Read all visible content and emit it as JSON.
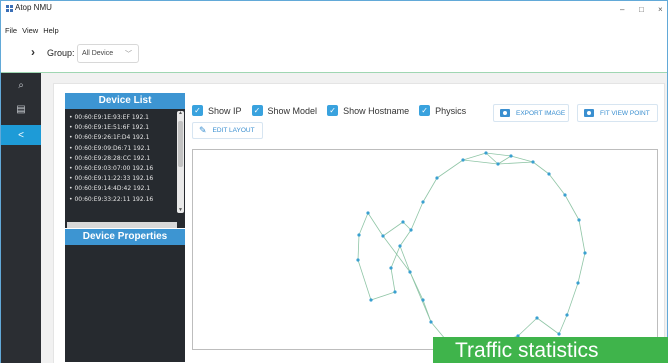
{
  "app": {
    "title": "Atop NMU",
    "window_controls": [
      "–",
      "□",
      "×"
    ]
  },
  "menu": [
    "File",
    "View",
    "Help"
  ],
  "group_bar": {
    "chevron_icon": "chevron-right-icon",
    "label": "Group:",
    "selected": "All Device",
    "dropdown_icon": "chevron-down-icon"
  },
  "sidebar": {
    "items": [
      {
        "icon": "search-icon",
        "glyph": "⌕"
      },
      {
        "icon": "list-icon",
        "glyph": "▤"
      },
      {
        "icon": "share-icon",
        "glyph": "<",
        "active": true
      }
    ]
  },
  "device_list": {
    "title": "Device List",
    "items": [
      "• 00:60:E9:1E:93:EF   192.1",
      "• 00:60:E9:1E:51:6F   192.1",
      "• 00:60:E9:26:1F:D4   192.1",
      "• 00:60:E9:09:D6:71   192.1",
      "• 00:60:E9:28:28:CC   192.1",
      "• 00:60:E9:03:07:00   192.16",
      "• 00:60:E9:11:22:33   192.16",
      "• 00:60:E9:14:4D:42   192.1",
      "• 00:60:E9:33:22:11   192.16"
    ]
  },
  "device_properties": {
    "title": "Device Properties"
  },
  "toolbar": {
    "show_ip": "Show IP",
    "show_model": "Show Model",
    "show_hostname": "Show Hostname",
    "physics": "Physics",
    "export_image": "EXPORT IMAGE",
    "fit_view_point": "FIT VIEW POINT",
    "edit_layout": "EDIT LAYOUT"
  },
  "colors": {
    "accent": "#39a2de",
    "sidebar": "#2b2e33",
    "node": "#3aa0d0",
    "edge": "#8fc5a6",
    "overlay": "#3fb44b"
  },
  "overlay": {
    "text": "Traffic statistics"
  }
}
